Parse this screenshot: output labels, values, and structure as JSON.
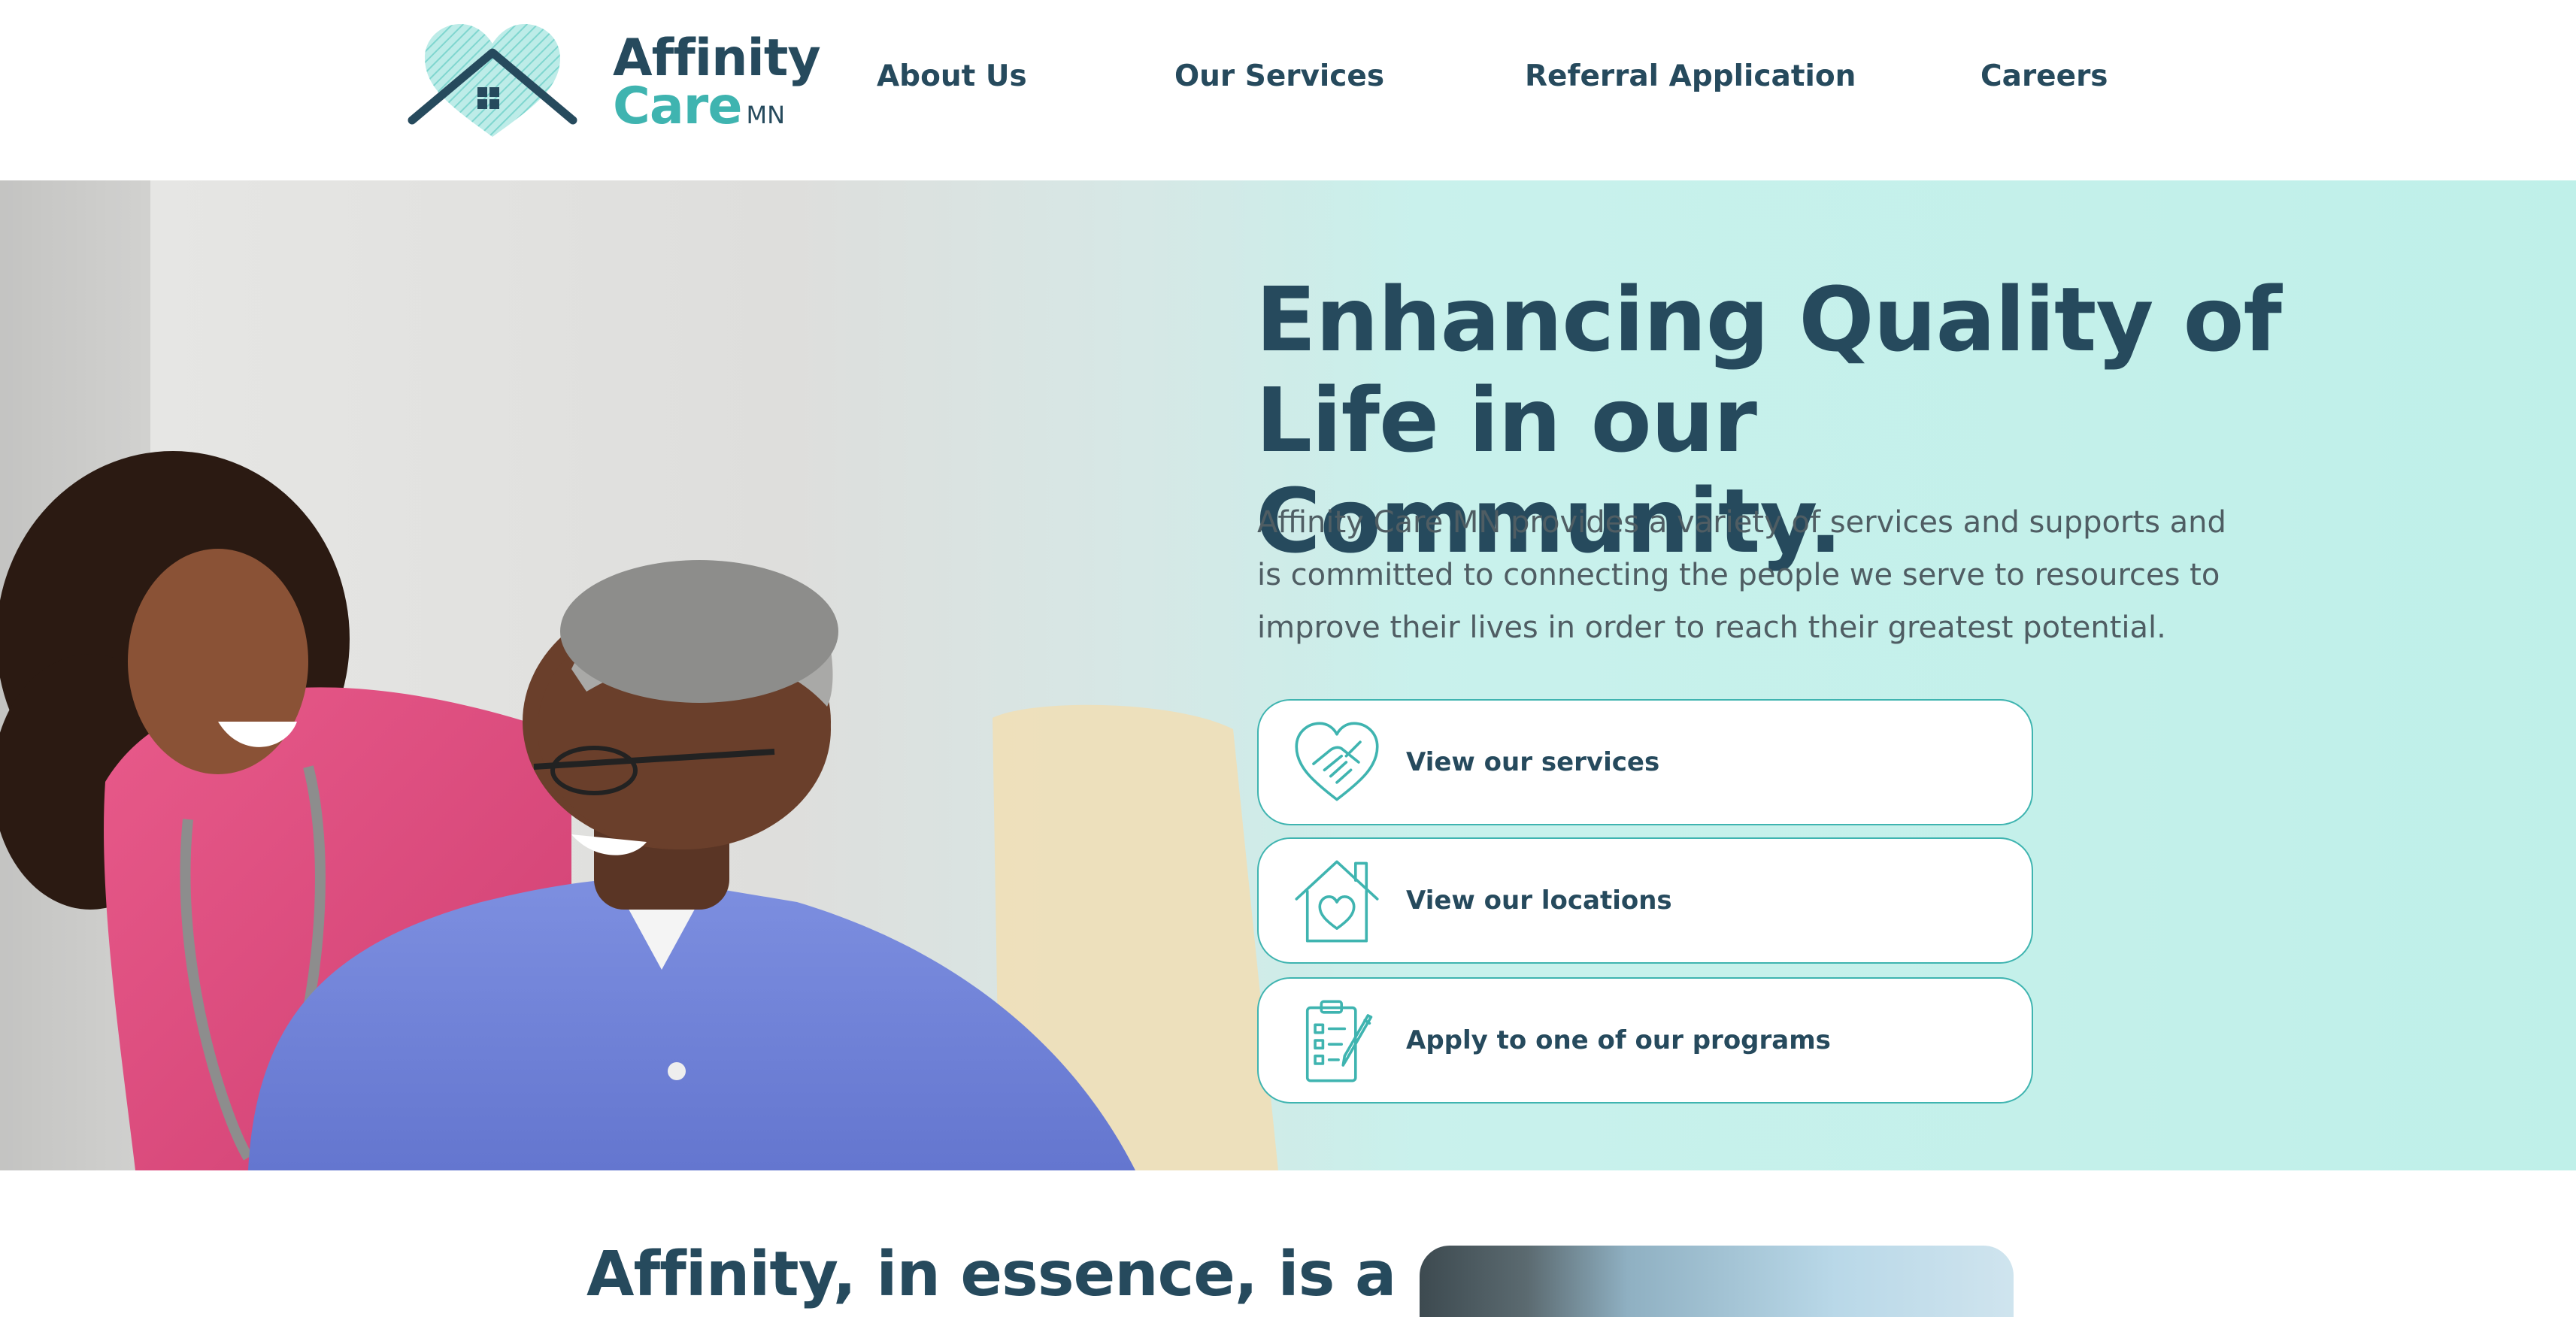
{
  "brand": {
    "name_line1": "Affinity",
    "name_line2": "Care",
    "name_suffix": "MN",
    "colors": {
      "navy": "#264a5d",
      "teal": "#3fb4b0",
      "mint": "#c9f1ec"
    }
  },
  "nav": {
    "items": [
      {
        "label": "About Us"
      },
      {
        "label": "Our Services"
      },
      {
        "label": "Referral Application"
      },
      {
        "label": "Careers"
      }
    ]
  },
  "hero": {
    "title_line1": "Enhancing Quality of",
    "title_line2": "Life in our Community.",
    "description": "Affinity Care MN provides a variety of services and supports and is committed to connecting the people we serve to resources to improve their lives in order to reach their greatest potential.",
    "ctas": [
      {
        "label": "View our services",
        "icon": "heart-handshake-icon"
      },
      {
        "label": "View our locations",
        "icon": "house-heart-icon"
      },
      {
        "label": "Apply to one of our programs",
        "icon": "clipboard-checklist-icon"
      }
    ]
  },
  "essence": {
    "title": "Affinity, in essence, is a"
  }
}
